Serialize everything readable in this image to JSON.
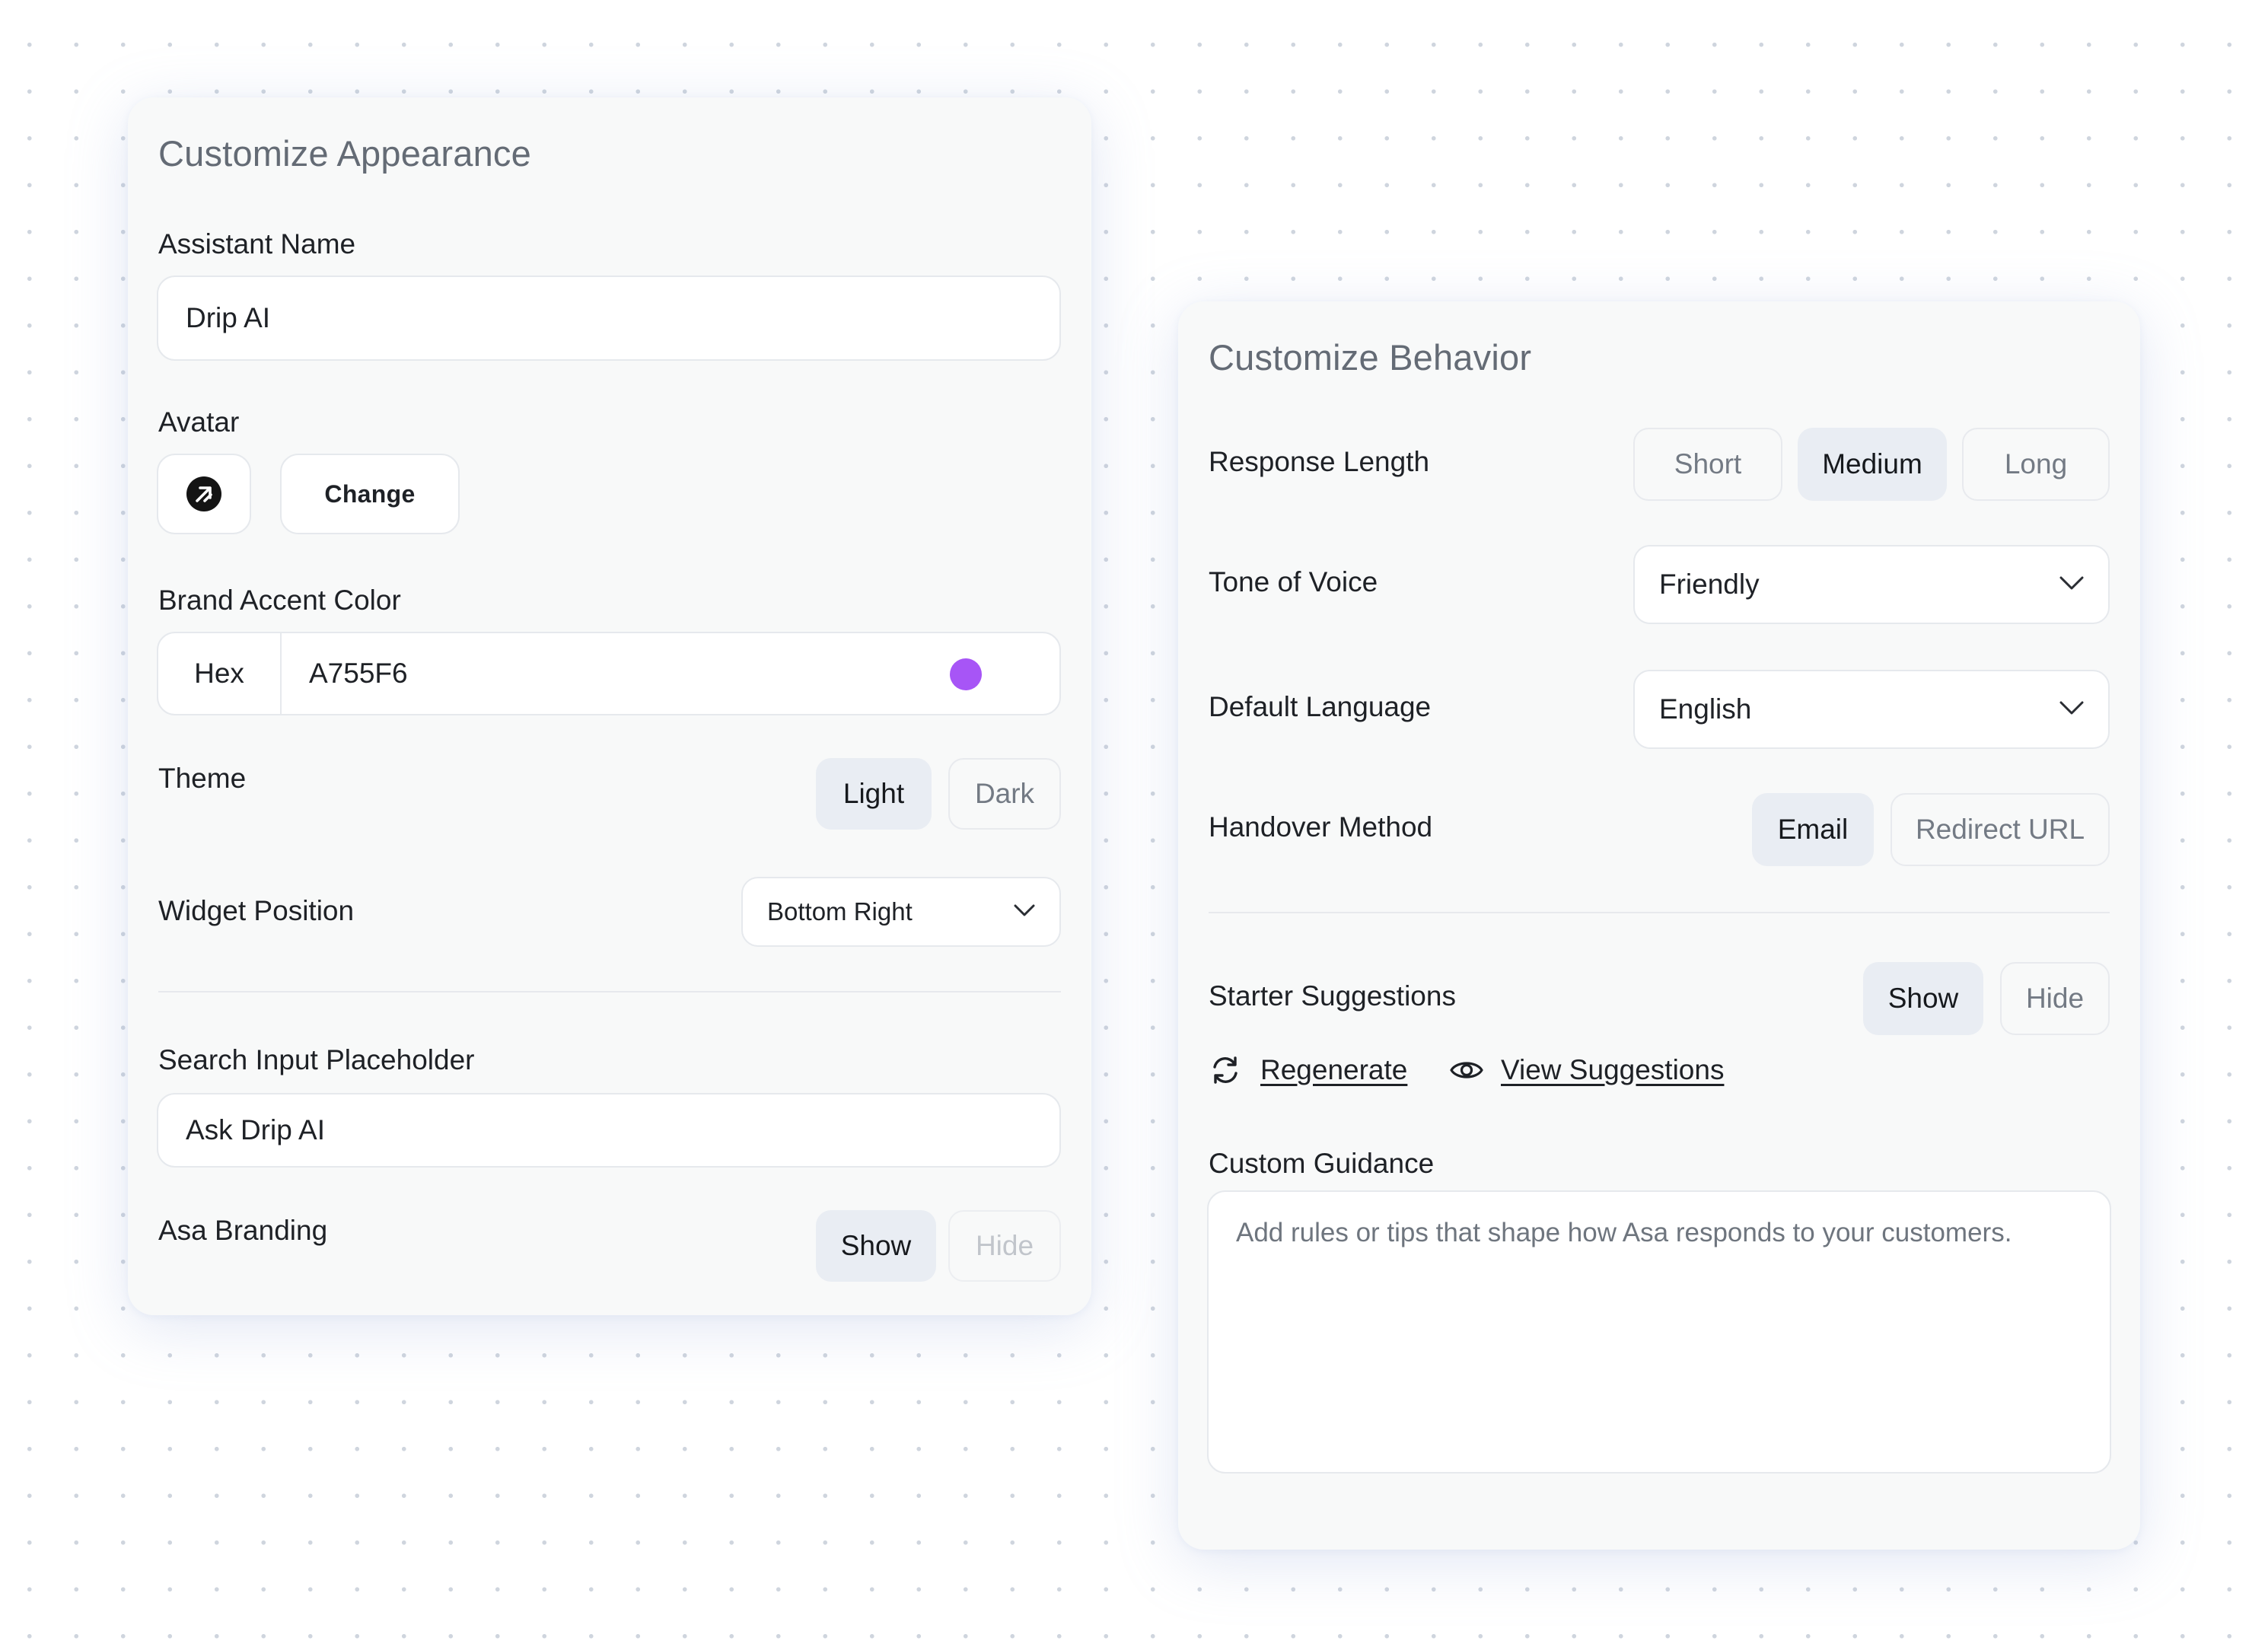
{
  "appearance": {
    "title": "Customize Appearance",
    "assistant_name_label": "Assistant Name",
    "assistant_name_value": "Drip AI",
    "avatar_label": "Avatar",
    "avatar_icon": "arrow-up-right-icon",
    "change_button": "Change",
    "accent_label": "Brand Accent Color",
    "hex_prefix": "Hex",
    "hex_value": "A755F6",
    "accent_color": "#A755F6",
    "theme_label": "Theme",
    "theme_options": [
      "Light",
      "Dark"
    ],
    "theme_selected": "Light",
    "widget_position_label": "Widget Position",
    "widget_position_value": "Bottom Right",
    "search_placeholder_label": "Search Input Placeholder",
    "search_placeholder_value": "Ask Drip AI",
    "branding_label": "Asa Branding",
    "branding_options": [
      "Show",
      "Hide"
    ],
    "branding_selected": "Show"
  },
  "behavior": {
    "title": "Customize Behavior",
    "response_length_label": "Response Length",
    "response_length_options": [
      "Short",
      "Medium",
      "Long"
    ],
    "response_length_selected": "Medium",
    "tone_label": "Tone of Voice",
    "tone_value": "Friendly",
    "language_label": "Default Language",
    "language_value": "English",
    "handover_label": "Handover Method",
    "handover_options": [
      "Email",
      "Redirect URL"
    ],
    "handover_selected": "Email",
    "starter_label": "Starter Suggestions",
    "starter_options": [
      "Show",
      "Hide"
    ],
    "starter_selected": "Show",
    "regenerate_link": "Regenerate",
    "view_suggestions_link": "View Suggestions",
    "guidance_label": "Custom Guidance",
    "guidance_placeholder": "Add rules or tips that shape how Asa responds to your customers."
  }
}
